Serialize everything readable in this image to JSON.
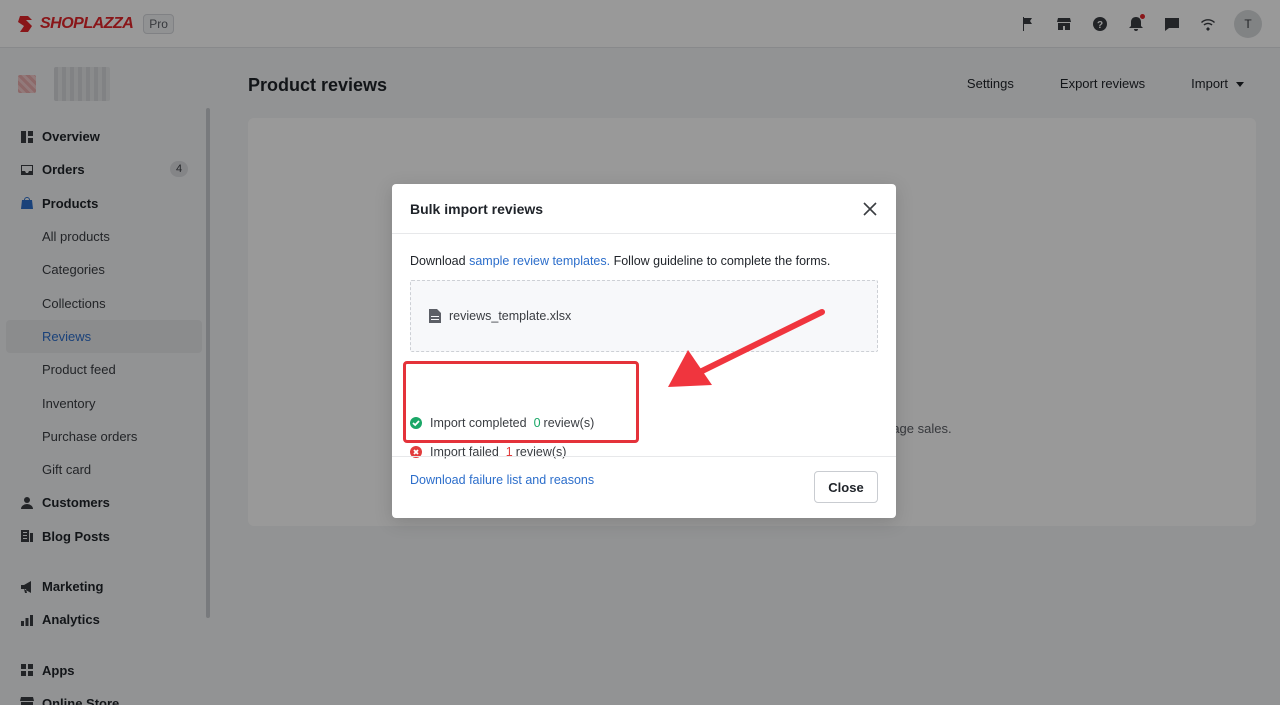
{
  "brand": {
    "name": "SHOPLAZZA",
    "plan": "Pro",
    "accent": "#e4252b"
  },
  "topbar": {
    "icons": [
      "flag-icon",
      "store-icon",
      "help-icon",
      "bell-icon",
      "chat-icon",
      "wifi-icon"
    ],
    "avatar_initial": "T"
  },
  "sidebar": {
    "items": [
      {
        "label": "Overview"
      },
      {
        "label": "Orders",
        "count": "4"
      },
      {
        "label": "Products"
      },
      {
        "label": "All products"
      },
      {
        "label": "Categories"
      },
      {
        "label": "Collections"
      },
      {
        "label": "Reviews"
      },
      {
        "label": "Product feed"
      },
      {
        "label": "Inventory"
      },
      {
        "label": "Purchase orders"
      },
      {
        "label": "Gift card"
      },
      {
        "label": "Customers"
      },
      {
        "label": "Blog Posts"
      },
      {
        "label": "Marketing"
      },
      {
        "label": "Analytics"
      },
      {
        "label": "Apps"
      },
      {
        "label": "Online Store"
      }
    ],
    "active": "Reviews"
  },
  "main": {
    "title": "Product reviews",
    "actions": {
      "settings": "Settings",
      "export": "Export reviews",
      "import": "Import"
    },
    "empty_hint_fragment": "rage sales."
  },
  "modal": {
    "title": "Bulk import reviews",
    "guideline": {
      "prefix": "Download ",
      "link": "sample review templates.",
      "suffix": " Follow guideline to complete the forms."
    },
    "file_name": "reviews_template.xlsx",
    "completed": {
      "label": "Import completed",
      "count": "0",
      "unit": "review(s)"
    },
    "failed": {
      "label": "Import failed",
      "count": "1",
      "unit": "review(s)"
    },
    "failure_link": "Download failure list and reasons",
    "close_label": "Close"
  },
  "colors": {
    "link": "#2c6ecb",
    "success": "#1aa767",
    "error": "#e23d3d",
    "annotation": "#e4323a"
  }
}
